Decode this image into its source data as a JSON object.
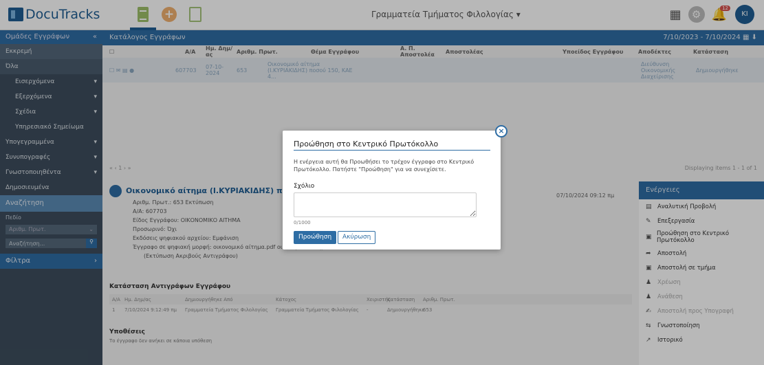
{
  "app": {
    "title": "DocuTracks",
    "department": "Γραμματεία Τμήματος Φιλολογίας ▾",
    "notifications": "12",
    "user_initials": "KI"
  },
  "sidebar": {
    "header": "Ομάδες Εγγράφων",
    "items": [
      {
        "label": "Εκκρεμή"
      },
      {
        "label": "Όλα"
      },
      {
        "label": "Εισερχόμενα",
        "arrow": "▾"
      },
      {
        "label": "Εξερχόμενα",
        "arrow": "▾"
      },
      {
        "label": "Σχέδια",
        "arrow": "▾"
      },
      {
        "label": "Υπηρεσιακό Σημείωμα"
      },
      {
        "label": "Υπογεγραμμένα",
        "arrow": "▾"
      },
      {
        "label": "Συνυπογραφές",
        "arrow": "▾"
      },
      {
        "label": "Γνωστοποιηθέντα",
        "arrow": "▾"
      },
      {
        "label": "Δημοσιευμένα"
      }
    ],
    "search": {
      "header": "Αναζήτηση",
      "field_label": "Πεδίο",
      "field_value": "Αριθμ. Πρωτ.",
      "input_placeholder": "Αναζήτηση..."
    },
    "filters": "Φίλτρα"
  },
  "list": {
    "title": "Κατάλογος Εγγράφων",
    "date_range": "7/10/2023 - 7/10/2024",
    "columns": [
      "Α/Α",
      "Ημ. Δημ/ας",
      "Αριθμ. Πρωτ.",
      "Θέμα Εγγράφου",
      "Α. Π. Αποστολέα",
      "Αποστολέας",
      "Υποείδος Εγγράφου",
      "Αποδέκτες",
      "Κατάσταση"
    ],
    "row": {
      "aa": "607703",
      "date": "07-10-2024",
      "protocol": "653",
      "subject": "Οικονομικό αίτημα (Ι.ΚΥΡΙΑΚΙΔΗΣ) ποσού 150, ΚΑΕ 4...",
      "recipients": "Διεύθυνση Οικονομικής Διαχείρισης",
      "status": "Δημιουργήθηκε"
    },
    "pager": "1",
    "displaying": "Displaying items 1 - 1 of 1"
  },
  "detail": {
    "title": "Οικονομικό αίτημα (Ι.ΚΥΡΙΑΚΙΔΗΣ) ποσού 150",
    "protocol": "Αριθμ. Πρωτ.: 653 Εκτύπωση",
    "aa": "Α/Α: 607703",
    "type": "Είδος Εγγράφου: ΟΙΚΟΝΟΜΙΚΟ ΑΙΤΗΜΑ",
    "draft": "Προσωρινό: Όχι",
    "digital": "Εκδόσεις ψηφιακού αρχείου: Εμφάνιση",
    "file_line": "Έγγραφο σε ψηφιακή μορφή: οικονομικό αίτημα.pdf  οικονομικό αίτημα.docx",
    "print_copy": "(Εκτύπωση Ακριβούς Αντιγράφου)",
    "date": "07/10/2024 09:12 πμ"
  },
  "copies": {
    "title": "Κατάσταση Αντιγράφων Εγγράφου",
    "headers": [
      "Α/Α",
      "Ημ. Δημ/ας",
      "Δημιουργήθηκε Από",
      "Κάτοχος",
      "Χειριστής",
      "Κατάσταση",
      "Αριθμ. Πρωτ."
    ],
    "row": [
      "1",
      "7/10/2024 9:12:49 πμ",
      "Γραμματεία Τμήματος Φιλολογίας",
      "Γραμματεία Τμήματος Φιλολογίας",
      "-",
      "Δημιουργήθηκε",
      "653"
    ]
  },
  "relations": {
    "title": "Υποθέσεις",
    "text": "Το έγγραφο δεν ανήκει σε κάποια υπόθεση"
  },
  "actions": {
    "title": "Ενέργειες",
    "items": [
      {
        "label": "Αναλυτική Προβολή",
        "icon": "▤"
      },
      {
        "label": "Επεξεργασία",
        "icon": "✎"
      },
      {
        "label": "Προώθηση στο Κεντρικό Πρωτόκολλο",
        "icon": "▣"
      },
      {
        "label": "Αποστολή",
        "icon": "➦"
      },
      {
        "label": "Αποστολή σε τμήμα",
        "icon": "▣"
      },
      {
        "label": "Χρέωση",
        "icon": "♟"
      },
      {
        "label": "Ανάθεση",
        "icon": "♟"
      },
      {
        "label": "Αποστολή προς Υπογραφή",
        "icon": "✍"
      },
      {
        "label": "Γνωστοποίηση",
        "icon": "⇆"
      },
      {
        "label": "Ιστορικό",
        "icon": "↗"
      }
    ]
  },
  "modal": {
    "title": "Προώθηση στο Κεντρικό Πρωτόκολλο",
    "text": "Η ενέργεια αυτή θα Προωθήσει το τρέχον έγγραφο στο Κεντρικό Πρωτόκολλο. Πατήστε \"Προώθηση\" για να συνεχίσετε.",
    "comment_label": "Σχόλιο",
    "counter": "0/1000",
    "confirm": "Προώθηση",
    "cancel": "Ακύρωση"
  }
}
